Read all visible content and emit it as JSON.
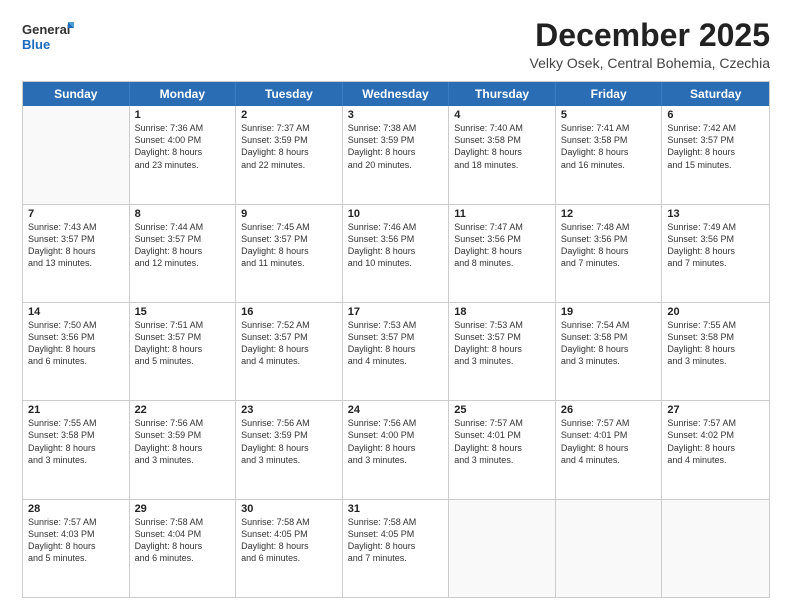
{
  "logo": {
    "line1": "General",
    "line2": "Blue"
  },
  "title": "December 2025",
  "subtitle": "Velky Osek, Central Bohemia, Czechia",
  "days": [
    "Sunday",
    "Monday",
    "Tuesday",
    "Wednesday",
    "Thursday",
    "Friday",
    "Saturday"
  ],
  "weeks": [
    [
      {
        "day": "",
        "info": ""
      },
      {
        "day": "1",
        "info": "Sunrise: 7:36 AM\nSunset: 4:00 PM\nDaylight: 8 hours\nand 23 minutes."
      },
      {
        "day": "2",
        "info": "Sunrise: 7:37 AM\nSunset: 3:59 PM\nDaylight: 8 hours\nand 22 minutes."
      },
      {
        "day": "3",
        "info": "Sunrise: 7:38 AM\nSunset: 3:59 PM\nDaylight: 8 hours\nand 20 minutes."
      },
      {
        "day": "4",
        "info": "Sunrise: 7:40 AM\nSunset: 3:58 PM\nDaylight: 8 hours\nand 18 minutes."
      },
      {
        "day": "5",
        "info": "Sunrise: 7:41 AM\nSunset: 3:58 PM\nDaylight: 8 hours\nand 16 minutes."
      },
      {
        "day": "6",
        "info": "Sunrise: 7:42 AM\nSunset: 3:57 PM\nDaylight: 8 hours\nand 15 minutes."
      }
    ],
    [
      {
        "day": "7",
        "info": "Sunrise: 7:43 AM\nSunset: 3:57 PM\nDaylight: 8 hours\nand 13 minutes."
      },
      {
        "day": "8",
        "info": "Sunrise: 7:44 AM\nSunset: 3:57 PM\nDaylight: 8 hours\nand 12 minutes."
      },
      {
        "day": "9",
        "info": "Sunrise: 7:45 AM\nSunset: 3:57 PM\nDaylight: 8 hours\nand 11 minutes."
      },
      {
        "day": "10",
        "info": "Sunrise: 7:46 AM\nSunset: 3:56 PM\nDaylight: 8 hours\nand 10 minutes."
      },
      {
        "day": "11",
        "info": "Sunrise: 7:47 AM\nSunset: 3:56 PM\nDaylight: 8 hours\nand 8 minutes."
      },
      {
        "day": "12",
        "info": "Sunrise: 7:48 AM\nSunset: 3:56 PM\nDaylight: 8 hours\nand 7 minutes."
      },
      {
        "day": "13",
        "info": "Sunrise: 7:49 AM\nSunset: 3:56 PM\nDaylight: 8 hours\nand 7 minutes."
      }
    ],
    [
      {
        "day": "14",
        "info": "Sunrise: 7:50 AM\nSunset: 3:56 PM\nDaylight: 8 hours\nand 6 minutes."
      },
      {
        "day": "15",
        "info": "Sunrise: 7:51 AM\nSunset: 3:57 PM\nDaylight: 8 hours\nand 5 minutes."
      },
      {
        "day": "16",
        "info": "Sunrise: 7:52 AM\nSunset: 3:57 PM\nDaylight: 8 hours\nand 4 minutes."
      },
      {
        "day": "17",
        "info": "Sunrise: 7:53 AM\nSunset: 3:57 PM\nDaylight: 8 hours\nand 4 minutes."
      },
      {
        "day": "18",
        "info": "Sunrise: 7:53 AM\nSunset: 3:57 PM\nDaylight: 8 hours\nand 3 minutes."
      },
      {
        "day": "19",
        "info": "Sunrise: 7:54 AM\nSunset: 3:58 PM\nDaylight: 8 hours\nand 3 minutes."
      },
      {
        "day": "20",
        "info": "Sunrise: 7:55 AM\nSunset: 3:58 PM\nDaylight: 8 hours\nand 3 minutes."
      }
    ],
    [
      {
        "day": "21",
        "info": "Sunrise: 7:55 AM\nSunset: 3:58 PM\nDaylight: 8 hours\nand 3 minutes."
      },
      {
        "day": "22",
        "info": "Sunrise: 7:56 AM\nSunset: 3:59 PM\nDaylight: 8 hours\nand 3 minutes."
      },
      {
        "day": "23",
        "info": "Sunrise: 7:56 AM\nSunset: 3:59 PM\nDaylight: 8 hours\nand 3 minutes."
      },
      {
        "day": "24",
        "info": "Sunrise: 7:56 AM\nSunset: 4:00 PM\nDaylight: 8 hours\nand 3 minutes."
      },
      {
        "day": "25",
        "info": "Sunrise: 7:57 AM\nSunset: 4:01 PM\nDaylight: 8 hours\nand 3 minutes."
      },
      {
        "day": "26",
        "info": "Sunrise: 7:57 AM\nSunset: 4:01 PM\nDaylight: 8 hours\nand 4 minutes."
      },
      {
        "day": "27",
        "info": "Sunrise: 7:57 AM\nSunset: 4:02 PM\nDaylight: 8 hours\nand 4 minutes."
      }
    ],
    [
      {
        "day": "28",
        "info": "Sunrise: 7:57 AM\nSunset: 4:03 PM\nDaylight: 8 hours\nand 5 minutes."
      },
      {
        "day": "29",
        "info": "Sunrise: 7:58 AM\nSunset: 4:04 PM\nDaylight: 8 hours\nand 6 minutes."
      },
      {
        "day": "30",
        "info": "Sunrise: 7:58 AM\nSunset: 4:05 PM\nDaylight: 8 hours\nand 6 minutes."
      },
      {
        "day": "31",
        "info": "Sunrise: 7:58 AM\nSunset: 4:05 PM\nDaylight: 8 hours\nand 7 minutes."
      },
      {
        "day": "",
        "info": ""
      },
      {
        "day": "",
        "info": ""
      },
      {
        "day": "",
        "info": ""
      }
    ]
  ]
}
